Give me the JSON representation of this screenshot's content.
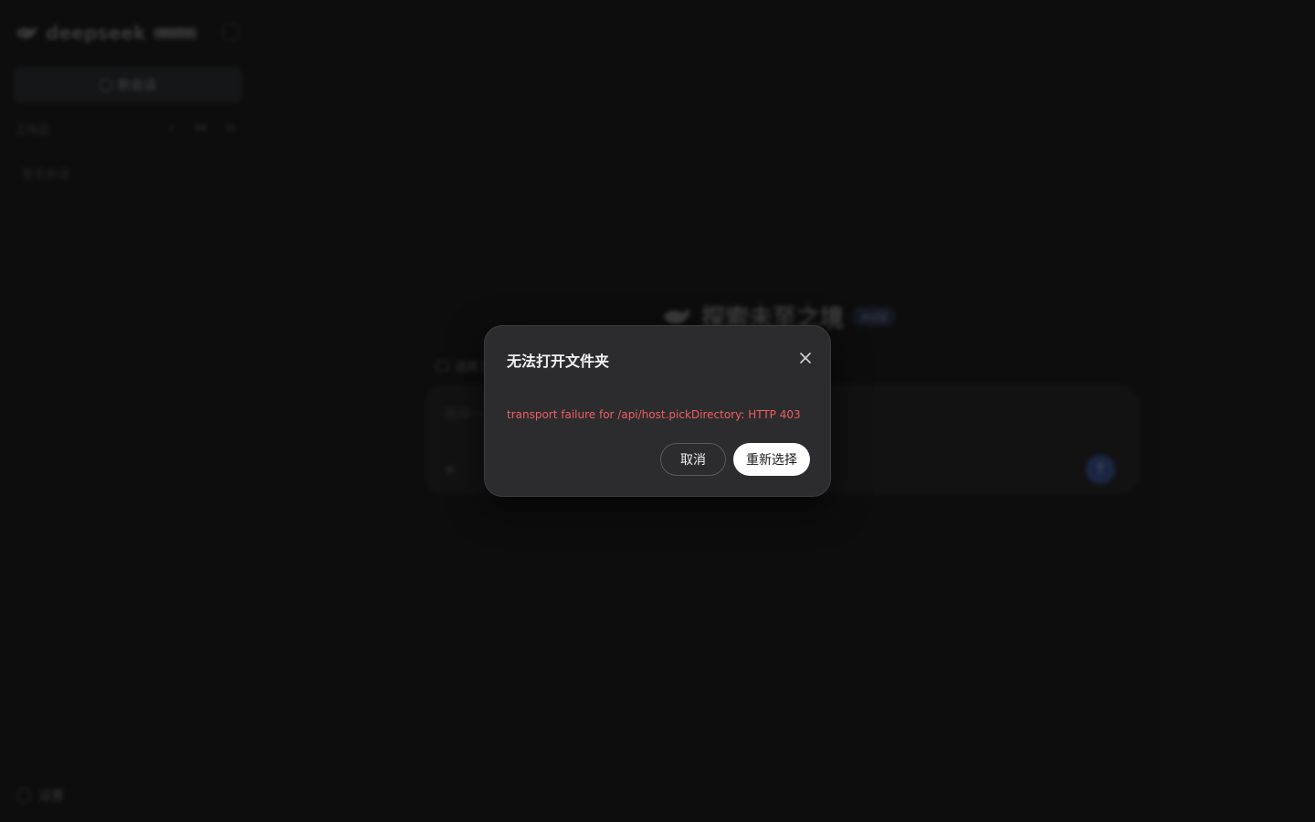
{
  "app": {
    "brand_name": "deepseek",
    "brand_badge": "WebTUI",
    "new_chat_label": "新会话",
    "workspace_label": "工作区",
    "empty_chats": "暂无会话",
    "settings_label": "设置"
  },
  "main": {
    "hero_title": "探索未至之境",
    "hero_badge": "测试版",
    "folder_label": "选择工",
    "composer_placeholder": "选择一",
    "composer_plus": "+",
    "send_icon": "↑"
  },
  "dialog": {
    "title": "无法打开文件夹",
    "error_message": "transport failure for /api/host.pickDirectory: HTTP 403",
    "cancel_label": "取消",
    "retry_label": "重新选择"
  },
  "colors": {
    "background": "#151515",
    "dialog_bg": "#2c2c2e",
    "error_text": "#ef5f5f",
    "primary_button_bg": "#ffffff"
  }
}
